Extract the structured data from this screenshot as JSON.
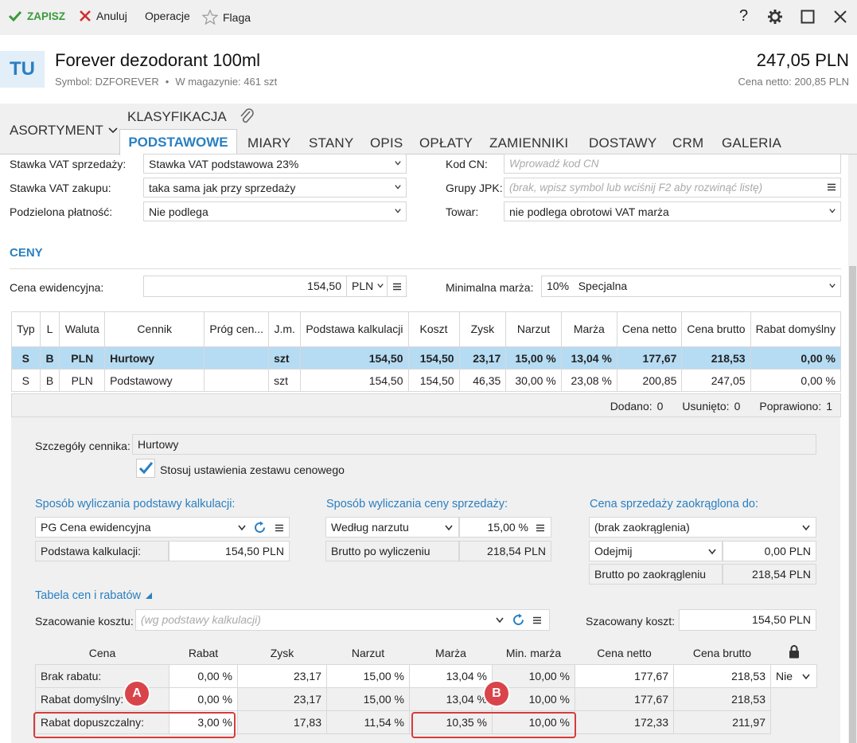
{
  "toolbar": {
    "save": "ZAPISZ",
    "cancel": "Anuluj",
    "operations": "Operacje",
    "flag": "Flaga",
    "help": "?"
  },
  "header": {
    "badge": "TU",
    "title": "Forever dezodorant 100ml",
    "symbol": "Symbol: DZFOREVER",
    "sep": "•",
    "stock": "W magazynie: 461 szt",
    "price": "247,05 PLN",
    "net_price": "Cena netto: 200,85 PLN"
  },
  "tabs": {
    "assortment": "ASORTYMENT",
    "classification": "KLASYFIKACJA",
    "items": [
      "PODSTAWOWE",
      "MIARY",
      "STANY",
      "OPIS",
      "OPŁATY",
      "ZAMIENNIKI",
      "DOSTAWY",
      "CRM",
      "GALERIA"
    ]
  },
  "vat": {
    "sale_label": "Stawka VAT sprzedaży:",
    "sale_value": "Stawka VAT podstawowa 23%",
    "purchase_label": "Stawka VAT zakupu:",
    "purchase_value": "taka sama jak przy sprzedaży",
    "split_label": "Podzielona płatność:",
    "split_value": "Nie podlega",
    "cn_label": "Kod CN:",
    "cn_placeholder": "Wprowadź kod CN",
    "jpk_label": "Grupy JPK:",
    "jpk_placeholder": "(brak, wpisz symbol lub wciśnij F2 aby rozwinąć listę)",
    "goods_label": "Towar:",
    "goods_value": "nie podlega obrotowi VAT marża"
  },
  "prices": {
    "section_title": "CENY",
    "evid_label": "Cena ewidencyjna:",
    "evid_value": "154,50",
    "evid_currency": "PLN",
    "min_margin_label": "Minimalna marża:",
    "min_margin_value": "10%",
    "min_margin_type": "Specjalna"
  },
  "price_table": {
    "headers": [
      "Typ",
      "L",
      "Waluta",
      "Cennik",
      "Próg cen...",
      "J.m.",
      "Podstawa kalkulacji",
      "Koszt",
      "Zysk",
      "Narzut",
      "Marża",
      "Cena netto",
      "Cena brutto",
      "Rabat domyślny"
    ],
    "rows": [
      [
        "S",
        "B",
        "PLN",
        "Hurtowy",
        "",
        "szt",
        "154,50",
        "154,50",
        "23,17",
        "15,00 %",
        "13,04 %",
        "177,67",
        "218,53",
        "0,00 %"
      ],
      [
        "S",
        "B",
        "PLN",
        "Podstawowy",
        "",
        "szt",
        "154,50",
        "154,50",
        "46,35",
        "30,00 %",
        "23,08 %",
        "200,85",
        "247,05",
        "0,00 %"
      ]
    ],
    "added_label": "Dodano:",
    "added": "0",
    "removed_label": "Usunięto:",
    "removed": "0",
    "fixed_label": "Poprawiono:",
    "fixed": "1"
  },
  "details": {
    "label": "Szczegóły cennika:",
    "value": "Hurtowy",
    "checkbox_label": "Stosuj ustawienia zestawu cenowego",
    "calc_title": "Sposób wyliczania podstawy kalkulacji:",
    "calc_value": "PG  Cena ewidencyjna",
    "calc_base_label": "Podstawa kalkulacji:",
    "calc_base_value": "154,50 PLN",
    "sale_title": "Sposób wyliczania ceny sprzedaży:",
    "sale_method": "Według narzutu",
    "sale_percent": "15,00 %",
    "sale_gross_label": "Brutto po wyliczeniu",
    "sale_gross_value": "218,54 PLN",
    "round_title": "Cena sprzedaży zaokrąglona do:",
    "round_value": "(brak zaokrąglenia)",
    "round_op": "Odejmij",
    "round_amount": "0,00 PLN",
    "round_gross_label": "Brutto po zaokrągleniu",
    "round_gross_value": "218,54 PLN",
    "table_title": "Tabela cen i rabatów",
    "cost_label": "Szacowanie kosztu:",
    "cost_placeholder": "(wg podstawy kalkulacji)",
    "est_cost_label": "Szacowany koszt:",
    "est_cost_value": "154,50 PLN"
  },
  "discount_table": {
    "headers": [
      "Cena",
      "Rabat",
      "Zysk",
      "Narzut",
      "Marża",
      "Min. marża",
      "Cena netto",
      "Cena brutto"
    ],
    "rows": [
      [
        "Brak rabatu:",
        "0,00 %",
        "23,17",
        "15,00 %",
        "13,04 %",
        "10,00 %",
        "177,67",
        "218,53"
      ],
      [
        "Rabat domyślny:",
        "0,00 %",
        "23,17",
        "15,00 %",
        "13,04 %",
        "10,00 %",
        "177,67",
        "218,53"
      ],
      [
        "Rabat dopuszczalny:",
        "3,00 %",
        "17,83",
        "11,54 %",
        "10,35 %",
        "10,00 %",
        "172,33",
        "211,97"
      ]
    ],
    "nie": "Nie"
  },
  "annotations": {
    "a": "A",
    "b": "B"
  },
  "colors": {
    "accent": "#2a7fc1",
    "selected_row": "#b6dcf3",
    "annotation": "#d63b3b",
    "save": "#3a9a3a",
    "cancel": "#d03030"
  }
}
